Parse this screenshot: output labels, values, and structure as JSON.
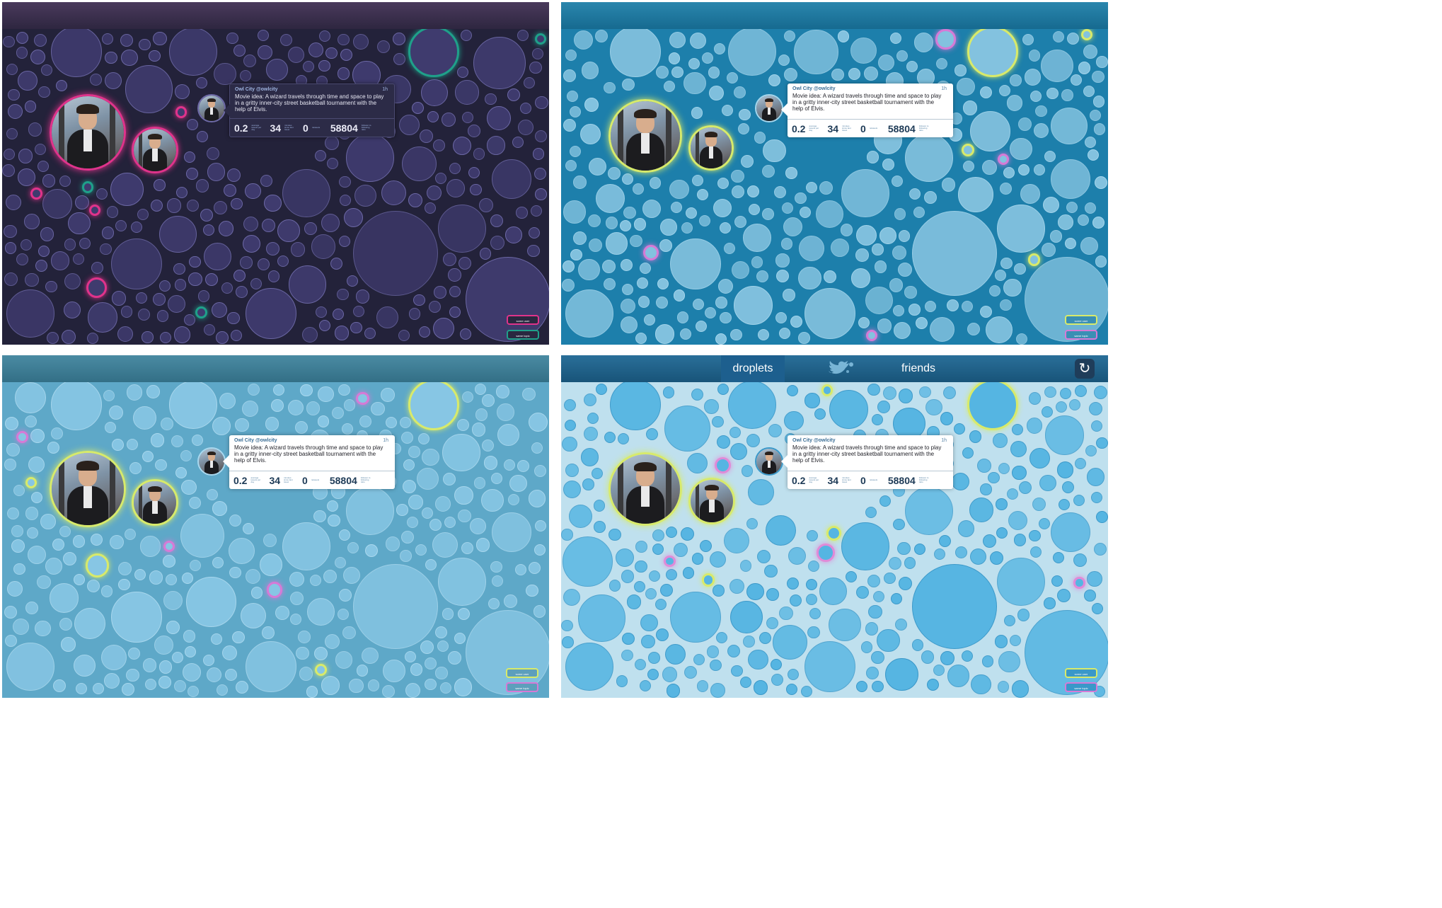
{
  "tweet": {
    "handle": "Owl City @owlcity",
    "time": "1h",
    "text": "Movie idea: A wizard travels through time and space to play in a gritty inner-city street basketball tournament with the help of Elvis.",
    "stats": [
      {
        "value": "0.2",
        "label": "average tweets per day"
      },
      {
        "value": "34",
        "label": "minutes since last tweet"
      },
      {
        "value": "0",
        "label": "retweets"
      },
      {
        "value": "58804",
        "label": "follower to following ratio"
      }
    ]
  },
  "corner_buttons": {
    "top": "some user",
    "bottom": "same topic"
  },
  "nav": {
    "tabs": [
      {
        "label": "droplets",
        "active": true
      },
      {
        "label": "friends",
        "active": false
      }
    ],
    "bird_icon": "twitter-bird-icon",
    "refresh_icon": "refresh-icon",
    "refresh_glyph": "↻"
  },
  "themes": [
    {
      "name": "purple",
      "background": "#23223a",
      "bar": "#3a2c4a",
      "bubble": "#3f3b6e",
      "bubble_border": "#6e6aa8",
      "highlight": [
        "#e0338b",
        "#1fa08a"
      ]
    },
    {
      "name": "blue",
      "background": "#1d7fab",
      "bar": "#1b6e92",
      "bubble": "#83c2df",
      "bubble_border": "#a6d6ec",
      "highlight": [
        "#d67ad6",
        "#d8ea6a"
      ]
    },
    {
      "name": "light-blue",
      "background": "#5ea8c8",
      "bar": "#3e7d95",
      "bubble": "#87c6e4",
      "bubble_border": "#aad8ee",
      "highlight": [
        "#d67ad6",
        "#d8ea6a"
      ]
    },
    {
      "name": "pale",
      "background": "#bfe0ee",
      "bar": "#1c5e86",
      "bubble": "#55b5e2",
      "bubble_border": "#3a98c9",
      "highlight": [
        "#e08ad8",
        "#d8ea6a"
      ]
    }
  ]
}
